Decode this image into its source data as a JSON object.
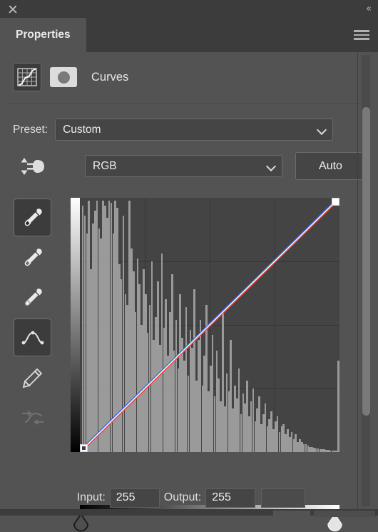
{
  "window": {
    "close_icon": "close-icon",
    "collapse_icon": "collapse-double-arrow-icon",
    "collapse_glyph": "«"
  },
  "tabs": [
    {
      "label": "Properties",
      "active": true
    }
  ],
  "panel_menu_icon": "hamburger-menu-icon",
  "adjustment": {
    "icon": "curves-adjustment-icon",
    "mask_icon": "layer-mask-thumbnail",
    "title": "Curves"
  },
  "preset": {
    "label": "Preset:",
    "value": "Custom",
    "chevron_icon": "chevron-down-icon"
  },
  "channel": {
    "targeted_adjustment_icon": "on-image-adjustment-icon",
    "value": "RGB",
    "chevron_icon": "chevron-down-icon",
    "auto_label": "Auto"
  },
  "tools": [
    {
      "name": "black-point-eyedropper",
      "active": true,
      "disabled": false
    },
    {
      "name": "gray-point-eyedropper",
      "active": false,
      "disabled": false
    },
    {
      "name": "white-point-eyedropper",
      "active": false,
      "disabled": false
    },
    {
      "name": "curve-point-tool",
      "active": true,
      "disabled": false
    },
    {
      "name": "pencil-draw-tool",
      "active": false,
      "disabled": false
    },
    {
      "name": "smooth-curve-tool",
      "active": false,
      "disabled": true
    }
  ],
  "io": {
    "input_label": "Input:",
    "input_value": "255",
    "output_label": "Output:",
    "output_value": "255"
  },
  "sliders": {
    "black_point": "black-point-slider",
    "white_point": "white-point-slider"
  },
  "colors": {
    "panel_bg": "#535353",
    "chrome_bg": "#3c3c3c",
    "field_bg": "#454545",
    "grid_bg": "#444444",
    "grid_line": "#353535",
    "histogram": "#9a9a9a",
    "curve_white": "#ffffff",
    "curve_red": "#ff3b3b",
    "curve_green": "#35e06a",
    "curve_blue": "#4a5bff",
    "text": "#e6e6e6"
  },
  "chart_data": {
    "type": "line",
    "title": "Curves",
    "xlabel": "Input",
    "ylabel": "Output",
    "xlim": [
      0,
      255
    ],
    "ylim": [
      0,
      255
    ],
    "grid": true,
    "grid_divisions": 4,
    "curve_points": [
      {
        "input": 0,
        "output": 0,
        "selected": true
      },
      {
        "input": 255,
        "output": 255,
        "selected": false
      }
    ],
    "curve_shape": "linear-identity",
    "channel": "RGB",
    "histogram": {
      "bins": 128,
      "values": [
        0.02,
        0.97,
        0.93,
        0.86,
        0.99,
        0.72,
        0.9,
        0.95,
        0.99,
        0.88,
        0.84,
        0.99,
        0.97,
        0.92,
        0.99,
        0.98,
        0.86,
        0.99,
        0.96,
        0.74,
        0.68,
        0.93,
        0.62,
        0.58,
        0.99,
        0.8,
        0.71,
        0.55,
        0.76,
        0.66,
        0.5,
        0.72,
        0.62,
        0.47,
        0.58,
        0.75,
        0.44,
        0.53,
        0.67,
        0.42,
        0.78,
        0.49,
        0.6,
        0.38,
        0.55,
        0.7,
        0.4,
        0.52,
        0.33,
        0.62,
        0.45,
        0.36,
        0.57,
        0.3,
        0.48,
        0.41,
        0.64,
        0.28,
        0.44,
        0.52,
        0.26,
        0.38,
        0.58,
        0.24,
        0.34,
        0.46,
        0.22,
        0.4,
        0.29,
        0.2,
        0.55,
        0.18,
        0.31,
        0.24,
        0.44,
        0.17,
        0.26,
        0.21,
        0.33,
        0.15,
        0.23,
        0.19,
        0.28,
        0.14,
        0.2,
        0.25,
        0.12,
        0.17,
        0.22,
        0.11,
        0.15,
        0.19,
        0.1,
        0.13,
        0.16,
        0.09,
        0.12,
        0.14,
        0.08,
        0.1,
        0.11,
        0.07,
        0.09,
        0.06,
        0.08,
        0.05,
        0.07,
        0.04,
        0.05,
        0.04,
        0.03,
        0.03,
        0.025,
        0.02,
        0.02,
        0.018,
        0.015,
        0.013,
        0.012,
        0.01,
        0.01,
        0.008,
        0.008,
        0.007,
        0.006,
        0.006,
        0.005,
        0.36
      ]
    }
  }
}
